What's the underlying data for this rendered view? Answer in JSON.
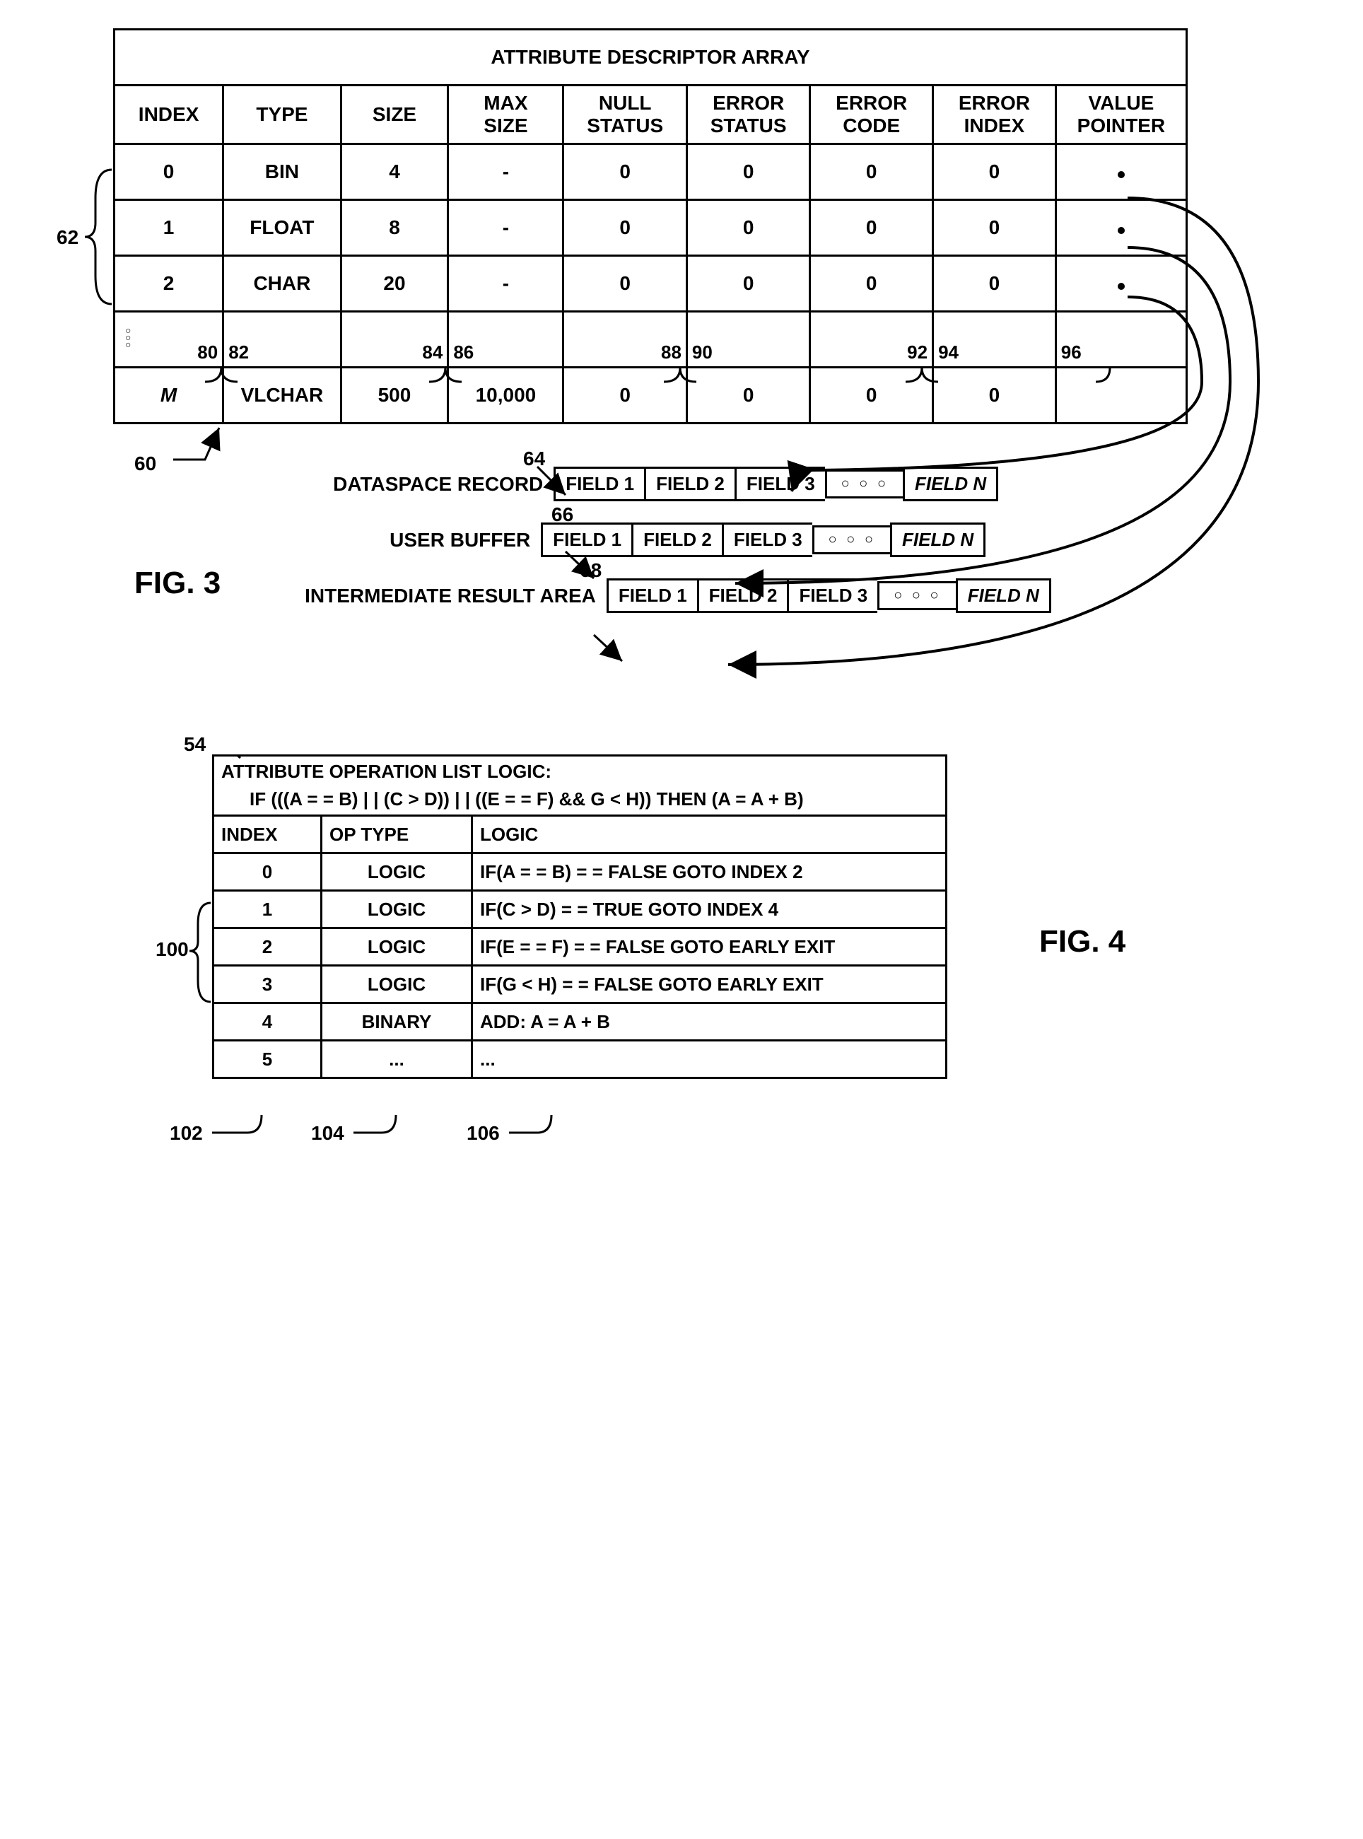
{
  "fig3": {
    "title": "ATTRIBUTE DESCRIPTOR ARRAY",
    "columns": [
      "INDEX",
      "TYPE",
      "SIZE",
      "MAX\nSIZE",
      "NULL\nSTATUS",
      "ERROR\nSTATUS",
      "ERROR\nCODE",
      "ERROR\nINDEX",
      "VALUE\nPOINTER"
    ],
    "rows": [
      {
        "index": "0",
        "type": "BIN",
        "size": "4",
        "max": "-",
        "null": "0",
        "errs": "0",
        "errc": "0",
        "erri": "0",
        "ptr": "•"
      },
      {
        "index": "1",
        "type": "FLOAT",
        "size": "8",
        "max": "-",
        "null": "0",
        "errs": "0",
        "errc": "0",
        "erri": "0",
        "ptr": "•"
      },
      {
        "index": "2",
        "type": "CHAR",
        "size": "20",
        "max": "-",
        "null": "0",
        "errs": "0",
        "errc": "0",
        "erri": "0",
        "ptr": "•"
      }
    ],
    "last_row": {
      "index": "M",
      "type": "VLCHAR",
      "size": "500",
      "max": "10,000",
      "null": "0",
      "errs": "0",
      "errc": "0",
      "erri": "0",
      "ptr": ""
    },
    "col_refs": {
      "c0": "80",
      "c1": "82",
      "c2": "84",
      "c3": "86",
      "c4": "88",
      "c5": "90",
      "c6": "92",
      "c7": "94",
      "c8": "96"
    },
    "bracket_ref": "62",
    "table_ref": "60",
    "records": [
      {
        "ref": "64",
        "label": "DATASPACE RECORD",
        "fields": [
          "FIELD 1",
          "FIELD 2",
          "FIELD 3"
        ],
        "last": "FIELD N"
      },
      {
        "ref": "66",
        "label": "USER BUFFER",
        "fields": [
          "FIELD 1",
          "FIELD 2",
          "FIELD 3"
        ],
        "last": "FIELD N"
      },
      {
        "ref": "68",
        "label": "INTERMEDIATE RESULT AREA",
        "fields": [
          "FIELD 1",
          "FIELD 2",
          "FIELD 3"
        ],
        "last": "FIELD N"
      }
    ],
    "figlabel": "FIG. 3"
  },
  "fig4": {
    "ref": "54",
    "header_line1": "ATTRIBUTE OPERATION LIST LOGIC:",
    "header_line2": "IF (((A = = B) | | (C > D)) | | ((E = = F) && G < H)) THEN (A = A + B)",
    "columns": [
      "INDEX",
      "OP TYPE",
      "LOGIC"
    ],
    "rows": [
      {
        "index": "0",
        "optype": "LOGIC",
        "logic": "IF(A = = B) = = FALSE GOTO INDEX 2"
      },
      {
        "index": "1",
        "optype": "LOGIC",
        "logic": "IF(C > D) = = TRUE GOTO INDEX 4"
      },
      {
        "index": "2",
        "optype": "LOGIC",
        "logic": "IF(E = = F) = = FALSE GOTO EARLY EXIT"
      },
      {
        "index": "3",
        "optype": "LOGIC",
        "logic": "IF(G < H) = = FALSE GOTO EARLY EXIT"
      },
      {
        "index": "4",
        "optype": "BINARY",
        "logic": "ADD: A = A + B"
      },
      {
        "index": "5",
        "optype": "...",
        "logic": "..."
      }
    ],
    "bracket_ref": "100",
    "col_refs": {
      "c0": "102",
      "c1": "104",
      "c2": "106"
    },
    "figlabel": "FIG. 4"
  }
}
